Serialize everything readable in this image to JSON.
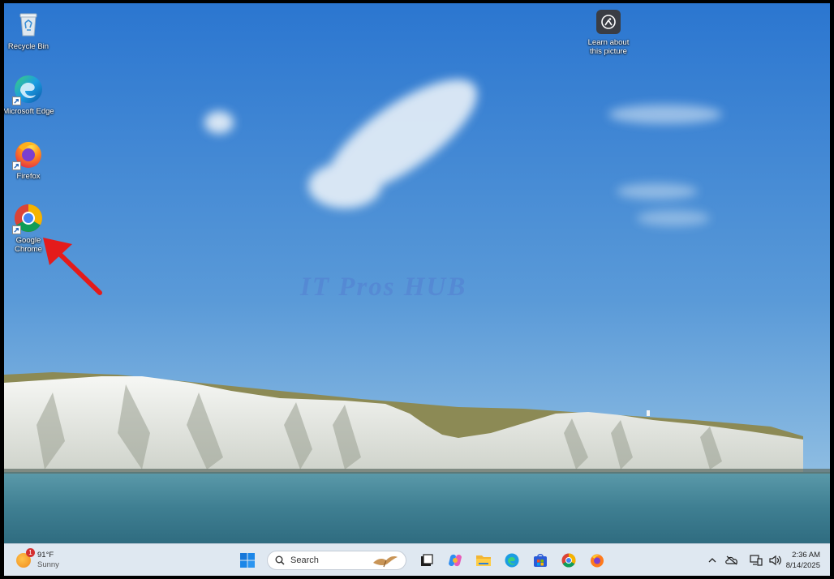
{
  "desktop": {
    "icons": [
      {
        "label": "Recycle Bin",
        "icon": "recycle-bin-icon"
      },
      {
        "label": "Microsoft Edge",
        "icon": "edge-icon"
      },
      {
        "label": "Firefox",
        "icon": "firefox-icon"
      },
      {
        "label": "Google Chrome",
        "icon": "chrome-icon"
      }
    ],
    "learn_about": "Learn about this picture",
    "watermark": "IT Pros HUB"
  },
  "taskbar": {
    "weather": {
      "temp": "91°F",
      "condition": "Sunny",
      "badge": "1"
    },
    "search_label": "Search",
    "pinned": [
      "start-icon",
      "task-view-icon",
      "copilot-icon",
      "file-explorer-icon",
      "edge-icon",
      "store-icon",
      "chrome-icon",
      "firefox-icon"
    ],
    "tray": [
      "chevron-up-icon",
      "onedrive-icon",
      "network-icon",
      "volume-icon"
    ],
    "time": "2:36 AM",
    "date": "8/14/2025"
  },
  "colors": {
    "sky_top": "#2e7ad4",
    "sky_bottom": "#9cc6e6",
    "sea": "#4f8ea0",
    "taskbar": "#dfe8f1",
    "arrow": "#e41b1b"
  }
}
